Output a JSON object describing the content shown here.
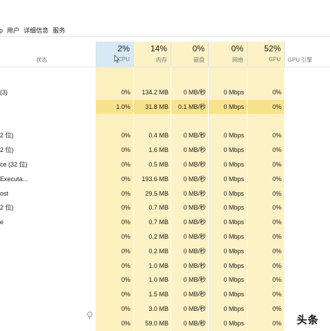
{
  "tabs": [
    "用户",
    "详细信息",
    "服务"
  ],
  "tab_prefix": "p",
  "header": {
    "status_label": "状态",
    "columns": [
      {
        "key": "cpu",
        "percent": "2%",
        "label": "CPU"
      },
      {
        "key": "mem",
        "percent": "14%",
        "label": "内存"
      },
      {
        "key": "disk",
        "percent": "0%",
        "label": "磁盘"
      },
      {
        "key": "net",
        "percent": "0%",
        "label": "网络"
      },
      {
        "key": "gpu",
        "percent": "52%",
        "label": "GPU"
      }
    ],
    "gpu_engine_label": "GPU 引擎"
  },
  "rows": [
    {
      "name": "(3)",
      "cpu": "0%",
      "mem": "134.2 MB",
      "disk": "0 MB/秒",
      "net": "0 Mbps",
      "gpu": "0%"
    },
    {
      "name": "",
      "cpu": "1.0%",
      "mem": "31.8 MB",
      "disk": "0.1 MB/秒",
      "net": "0 Mbps",
      "gpu": "0%",
      "highlight": true
    },
    {
      "name": "",
      "cpu": "",
      "mem": "",
      "disk": "",
      "net": "",
      "gpu": ""
    },
    {
      "name": "2 位)",
      "cpu": "0%",
      "mem": "0.4 MB",
      "disk": "0 MB/秒",
      "net": "0 Mbps",
      "gpu": "0%"
    },
    {
      "name": "2 位)",
      "cpu": "0%",
      "mem": "1.6 MB",
      "disk": "0 MB/秒",
      "net": "0 Mbps",
      "gpu": "0%"
    },
    {
      "name": "ce (32 位)",
      "cpu": "0%",
      "mem": "0.5 MB",
      "disk": "0 MB/秒",
      "net": "0 Mbps",
      "gpu": "0%"
    },
    {
      "name": "Executa...",
      "cpu": "0%",
      "mem": "193.6 MB",
      "disk": "0 MB/秒",
      "net": "0 Mbps",
      "gpu": "0%"
    },
    {
      "name": "ost",
      "cpu": "0%",
      "mem": "29.5 MB",
      "disk": "0 MB/秒",
      "net": "0 Mbps",
      "gpu": "0%"
    },
    {
      "name": "2 位)",
      "cpu": "0%",
      "mem": "0.7 MB",
      "disk": "0 MB/秒",
      "net": "0 Mbps",
      "gpu": "0%"
    },
    {
      "name": "e",
      "cpu": "0%",
      "mem": "0.7 MB",
      "disk": "0 MB/秒",
      "net": "0 Mbps",
      "gpu": "0%"
    },
    {
      "name": "",
      "cpu": "0%",
      "mem": "0.2 MB",
      "disk": "0 MB/秒",
      "net": "0 Mbps",
      "gpu": "0%"
    },
    {
      "name": "",
      "cpu": "0%",
      "mem": "0.2 MB",
      "disk": "0 MB/秒",
      "net": "0 Mbps",
      "gpu": "0%"
    },
    {
      "name": "",
      "cpu": "0%",
      "mem": "1.0 MB",
      "disk": "0 MB/秒",
      "net": "0 Mbps",
      "gpu": "0%"
    },
    {
      "name": "",
      "cpu": "0%",
      "mem": "1.0 MB",
      "disk": "0 MB/秒",
      "net": "0 Mbps",
      "gpu": "0%"
    },
    {
      "name": "",
      "cpu": "0%",
      "mem": "1.5 MB",
      "disk": "0 MB/秒",
      "net": "0 Mbps",
      "gpu": "0%"
    },
    {
      "name": "",
      "cpu": "0%",
      "mem": "3.0 MB",
      "disk": "0 MB/秒",
      "net": "0 Mbps",
      "gpu": "0%"
    },
    {
      "name": "",
      "cpu": "0%",
      "mem": "59.0 MB",
      "disk": "0 MB/秒",
      "net": "0 Mbps",
      "gpu": "0%"
    }
  ],
  "watermark": "头条",
  "colors": {
    "column_tint": "#fcf2c6",
    "row_highlight": "#f8e38d",
    "cpu_header_selected": "#d6e9f7"
  }
}
